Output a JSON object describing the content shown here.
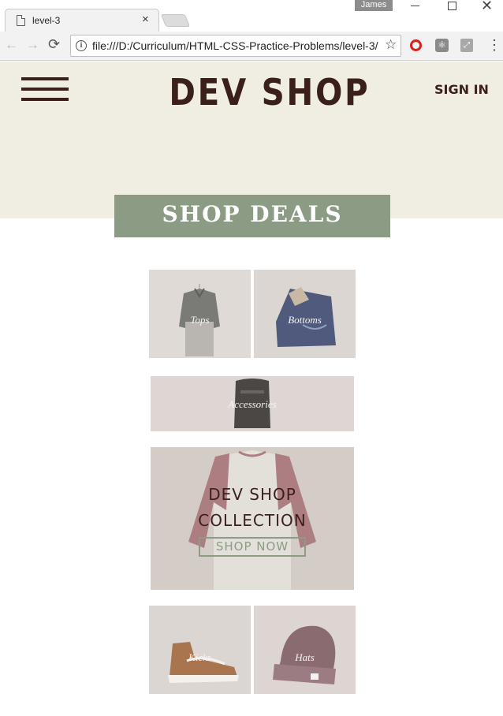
{
  "browser": {
    "tab_title": "level-3",
    "tab_close_label": "×",
    "profile_name": "James",
    "back_label": "←",
    "forward_label": "→",
    "reload_label": "⟳",
    "info_label": "i",
    "url": "file:///D:/Curriculum/HTML-CSS-Practice-Problems/level-3/",
    "star_label": "☆",
    "extensions": [
      "opera-icon",
      "react-devtools-icon",
      "pdf-icon"
    ],
    "menu_label": "⋮",
    "window_close_label": "✕"
  },
  "header": {
    "logo": "DEV SHOP",
    "sign_in": "SIGN IN"
  },
  "banner": {
    "label": "SHOP DEALS"
  },
  "categories": {
    "tops": "Tops",
    "bottoms": "Bottoms",
    "accessories": "Accessories",
    "kicks": "Kicks",
    "hats": "Hats"
  },
  "collection": {
    "title": "DEV SHOP\nCOLLECTION",
    "button": "SHOP NOW"
  },
  "colors": {
    "hero_bg": "#f0eee3",
    "brand_brown": "#3b1f1b",
    "sage_green": "#8c9c84"
  }
}
